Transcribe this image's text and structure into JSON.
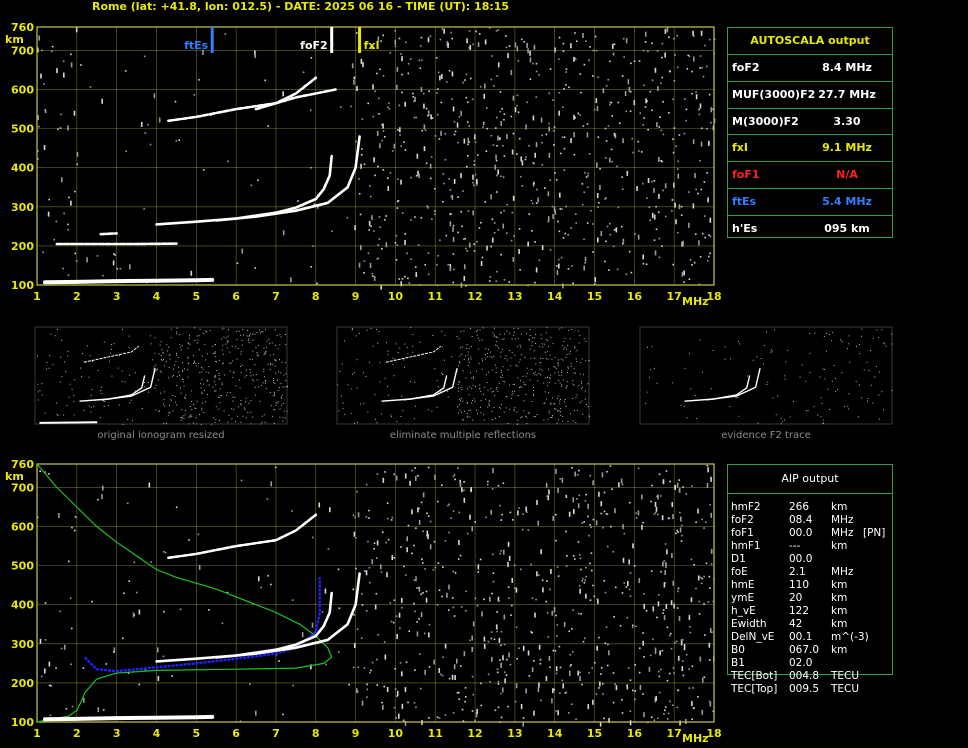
{
  "header": {
    "station_line": "Rome (lat: +41.8, lon: 012.5) - DATE: 2025 06 16 - TIME (UT): 18:15"
  },
  "colors": {
    "grid": "#c8c850",
    "panel_border": "#2fa04a",
    "autoscala_label": "#e8e800",
    "foF2": "#ffffff",
    "fxI": "#e8e800",
    "foF1": "#ff2020",
    "ftEs": "#2f7fff",
    "profile": "#20c020",
    "aip_trace": "#2020ff",
    "echo": "#ffffff",
    "noise": "#9a9a9a"
  },
  "top_ionogram": {
    "y_unit": "km",
    "x_unit": "MHz",
    "marker_labels": {
      "ftEs": "ftEs",
      "foF2": "foF2",
      "fxI": "fxI"
    }
  },
  "autoscala": {
    "title": "AUTOSCALA output",
    "rows": [
      {
        "label": "foF2",
        "value": "8.4 MHz",
        "color": "#ffffff"
      },
      {
        "label": "MUF(3000)F2",
        "value": "27.7 MHz",
        "color": "#ffffff"
      },
      {
        "label": "M(3000)F2",
        "value": "3.30",
        "color": "#ffffff"
      },
      {
        "label": "fxI",
        "value": "9.1 MHz",
        "color": "#e8e800"
      },
      {
        "label": "foF1",
        "value": "N/A",
        "color": "#ff2020"
      },
      {
        "label": "ftEs",
        "value": "5.4 MHz",
        "color": "#2f7fff"
      },
      {
        "label": "h'Es",
        "value": "095     km",
        "color": "#ffffff"
      }
    ]
  },
  "thumbnails": {
    "captions": [
      "original ionogram resized",
      "eliminate multiple reflections",
      "evidence F2 trace"
    ]
  },
  "bottom_ionogram": {
    "y_unit": "km",
    "x_unit": "MHz"
  },
  "aip": {
    "title": "AIP output",
    "rows": [
      [
        "hmF2",
        "266",
        "km",
        ""
      ],
      [
        "foF2",
        "08.4",
        "MHz",
        ""
      ],
      [
        "foF1",
        "00.0",
        "MHz",
        "[PN]"
      ],
      [
        "hmF1",
        "---",
        "km",
        ""
      ],
      [
        "D1",
        "00.0",
        "",
        ""
      ],
      [
        "foE",
        "2.1",
        "MHz",
        ""
      ],
      [
        "hmE",
        "110",
        "km",
        ""
      ],
      [
        "ymE",
        "20",
        "km",
        ""
      ],
      [
        "h_vE",
        "122",
        "km",
        ""
      ],
      [
        "Ewidth",
        "42",
        "km",
        ""
      ],
      [
        "DelN_vE",
        "00.1",
        "m^(-3)",
        ""
      ],
      [
        "B0",
        "067.0",
        "km",
        ""
      ],
      [
        "B1",
        "02.0",
        "",
        ""
      ],
      [
        "TEC[Bot]",
        "004.8",
        "TECU",
        ""
      ],
      [
        "TEC[Top]",
        "009.5",
        "TECU",
        ""
      ]
    ]
  },
  "chart_data": [
    {
      "type": "scatter",
      "title": "",
      "xlabel": "MHz",
      "ylabel": "km",
      "xlim": [
        1,
        18
      ],
      "ylim": [
        100,
        760
      ],
      "xticks": [
        1,
        2,
        3,
        4,
        5,
        6,
        7,
        8,
        9,
        10,
        11,
        12,
        13,
        14,
        15,
        16,
        17,
        18
      ],
      "yticks": [
        100,
        200,
        300,
        400,
        500,
        600,
        700,
        760
      ],
      "grid": true,
      "markers": [
        {
          "name": "ftEs",
          "x": 5.4
        },
        {
          "name": "foF2",
          "x": 8.4
        },
        {
          "name": "fxI",
          "x": 9.1
        }
      ],
      "series": [
        {
          "name": "E/Es trace",
          "points": [
            [
              1.2,
              107
            ],
            [
              2,
              108
            ],
            [
              3,
              110
            ],
            [
              4,
              111
            ],
            [
              5,
              112
            ],
            [
              5.4,
              113
            ]
          ]
        },
        {
          "name": "Es 2nd hop",
          "points": [
            [
              1.5,
              205
            ],
            [
              2.5,
              205
            ],
            [
              3.5,
              205
            ],
            [
              4.5,
              206
            ]
          ]
        },
        {
          "name": "Es hop 2b",
          "points": [
            [
              2.6,
              230
            ],
            [
              3,
              232
            ]
          ]
        },
        {
          "name": "F2 ordinary",
          "points": [
            [
              4,
              255
            ],
            [
              5,
              262
            ],
            [
              6,
              270
            ],
            [
              7,
              285
            ],
            [
              7.5,
              298
            ],
            [
              8,
              320
            ],
            [
              8.2,
              345
            ],
            [
              8.35,
              380
            ],
            [
              8.4,
              430
            ]
          ]
        },
        {
          "name": "F2 extraordinary",
          "points": [
            [
              5.5,
              265
            ],
            [
              6.5,
              275
            ],
            [
              7.5,
              290
            ],
            [
              8.3,
              310
            ],
            [
              8.8,
              350
            ],
            [
              9.0,
              400
            ],
            [
              9.1,
              480
            ]
          ]
        },
        {
          "name": "F2 2nd hop o",
          "points": [
            [
              4.3,
              520
            ],
            [
              5,
              530
            ],
            [
              6,
              550
            ],
            [
              7,
              565
            ],
            [
              7.5,
              590
            ],
            [
              8,
              630
            ]
          ]
        },
        {
          "name": "F2 2nd hop x",
          "points": [
            [
              6.5,
              550
            ],
            [
              7.5,
              580
            ],
            [
              8.5,
              600
            ]
          ]
        }
      ]
    },
    {
      "type": "line",
      "title": "",
      "xlabel": "MHz",
      "ylabel": "km",
      "xlim": [
        1,
        18
      ],
      "ylim": [
        100,
        760
      ],
      "xticks": [
        1,
        2,
        3,
        4,
        5,
        6,
        7,
        8,
        9,
        10,
        11,
        12,
        13,
        14,
        15,
        16,
        17,
        18
      ],
      "yticks": [
        100,
        200,
        300,
        400,
        500,
        600,
        700,
        760
      ],
      "grid": true,
      "series": [
        {
          "name": "profile",
          "points": [
            [
              1,
              760
            ],
            [
              1.5,
              700
            ],
            [
              2,
              650
            ],
            [
              2.5,
              600
            ],
            [
              3,
              560
            ],
            [
              3.5,
              525
            ],
            [
              4,
              490
            ],
            [
              4.5,
              470
            ],
            [
              5,
              455
            ],
            [
              5.5,
              440
            ],
            [
              6,
              420
            ],
            [
              7,
              380
            ],
            [
              7.6,
              350
            ],
            [
              8,
              320
            ],
            [
              8.3,
              290
            ],
            [
              8.4,
              266
            ],
            [
              8.2,
              250
            ],
            [
              7.5,
              238
            ],
            [
              6,
              235
            ],
            [
              4,
              232
            ],
            [
              3,
              225
            ],
            [
              2.5,
              210
            ],
            [
              2.2,
              175
            ],
            [
              2.1,
              150
            ],
            [
              2.0,
              130
            ],
            [
              1.8,
              115
            ],
            [
              1.4,
              108
            ],
            [
              1.0,
              100
            ]
          ]
        },
        {
          "name": "aip trace",
          "points": [
            [
              2.2,
              265
            ],
            [
              2.5,
              235
            ],
            [
              3,
              230
            ],
            [
              4,
              240
            ],
            [
              5,
              250
            ],
            [
              6,
              262
            ],
            [
              7,
              275
            ],
            [
              7.5,
              290
            ],
            [
              8,
              330
            ],
            [
              8.1,
              380
            ],
            [
              8.1,
              470
            ]
          ]
        },
        {
          "name": "F2 ordinary",
          "points": [
            [
              4,
              255
            ],
            [
              5,
              262
            ],
            [
              6,
              270
            ],
            [
              7,
              285
            ],
            [
              7.5,
              298
            ],
            [
              8,
              320
            ],
            [
              8.2,
              345
            ],
            [
              8.35,
              380
            ],
            [
              8.4,
              430
            ]
          ]
        },
        {
          "name": "F2 extraordinary",
          "points": [
            [
              5.5,
              265
            ],
            [
              6.5,
              275
            ],
            [
              7.5,
              290
            ],
            [
              8.3,
              310
            ],
            [
              8.8,
              350
            ],
            [
              9.0,
              400
            ],
            [
              9.1,
              480
            ]
          ]
        },
        {
          "name": "E/Es trace",
          "points": [
            [
              1.2,
              107
            ],
            [
              2,
              108
            ],
            [
              3,
              110
            ],
            [
              4,
              111
            ],
            [
              5,
              112
            ],
            [
              5.4,
              113
            ]
          ]
        },
        {
          "name": "F2 2nd hop o",
          "points": [
            [
              4.3,
              520
            ],
            [
              5,
              530
            ],
            [
              6,
              550
            ],
            [
              7,
              565
            ],
            [
              7.5,
              590
            ],
            [
              8,
              630
            ]
          ]
        }
      ]
    }
  ]
}
